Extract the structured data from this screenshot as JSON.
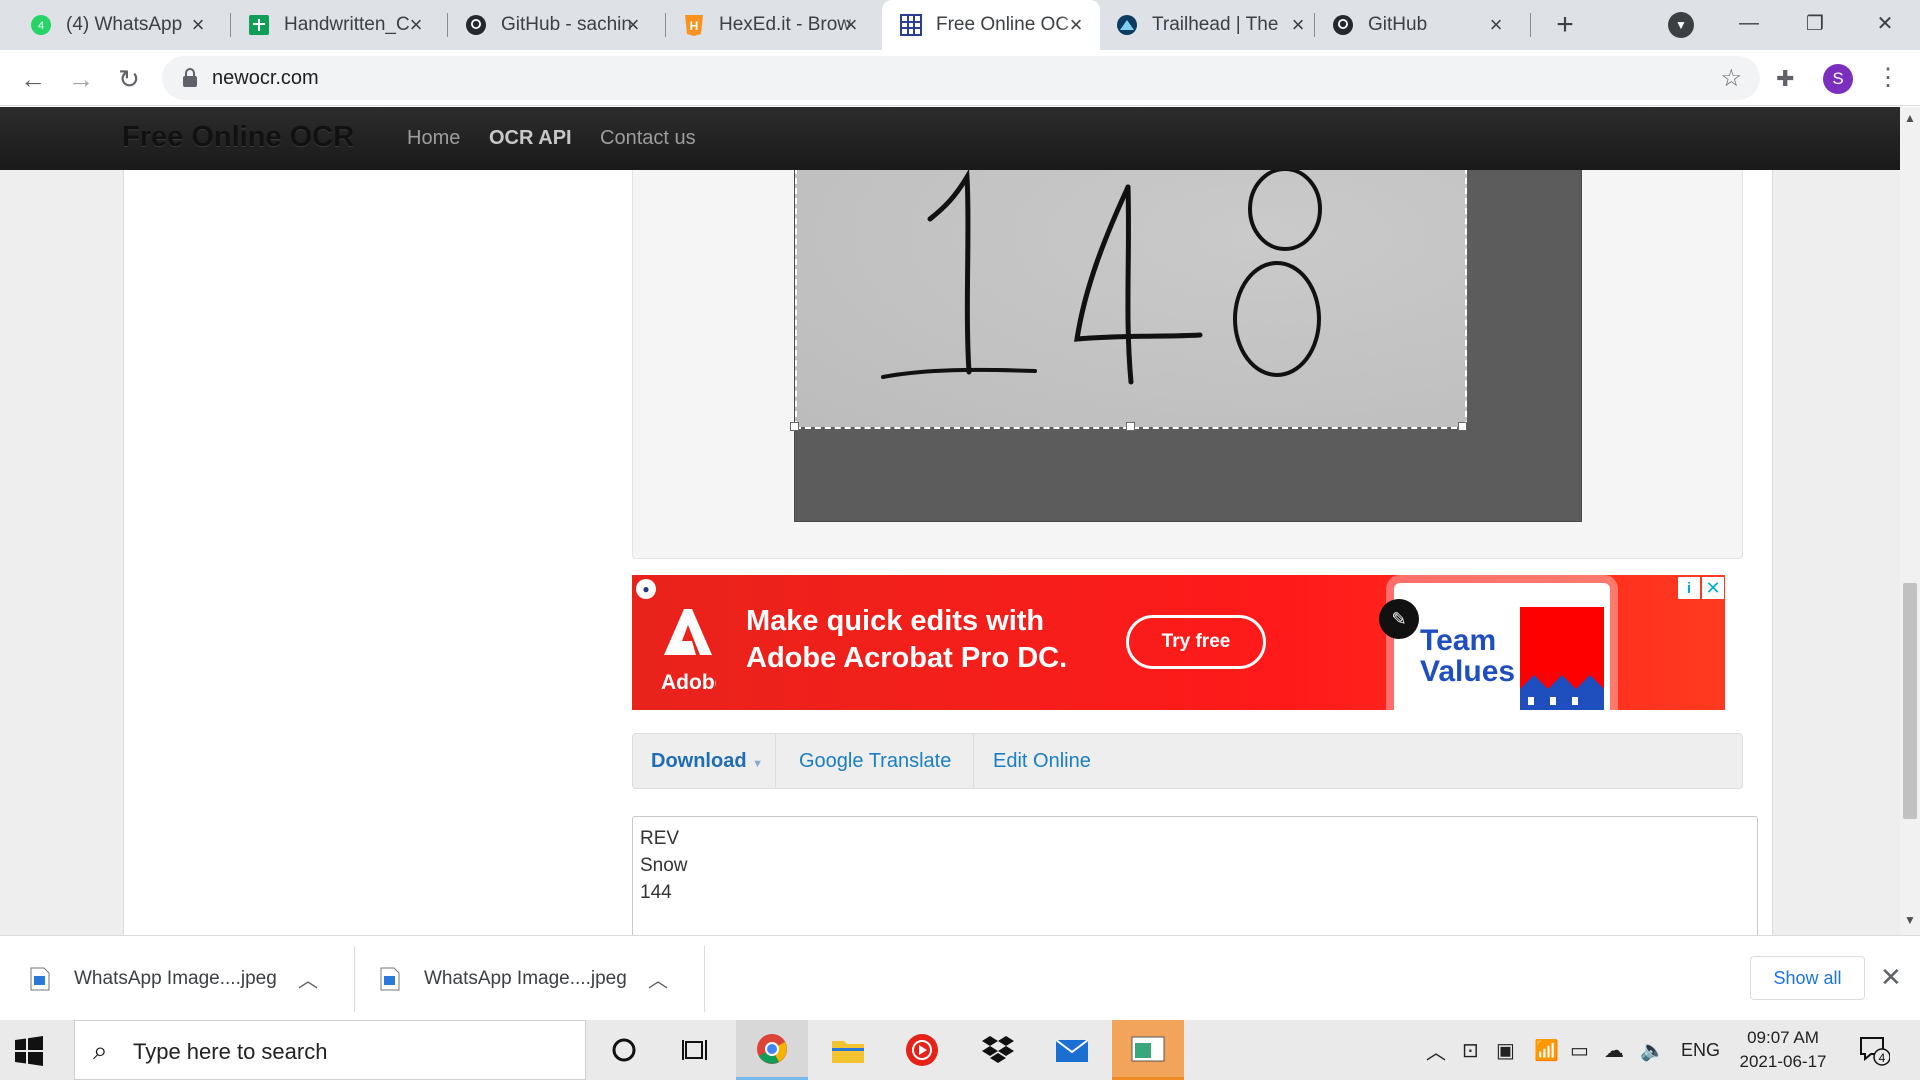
{
  "browser": {
    "tabs": [
      {
        "title": "(4) WhatsApp",
        "icon": "whatsapp-icon"
      },
      {
        "title": "Handwritten_C",
        "icon": "sheets-icon"
      },
      {
        "title": "GitHub - sachin",
        "icon": "github-icon"
      },
      {
        "title": "HexEd.it - Brow",
        "icon": "hexed-icon"
      },
      {
        "title": "Free Online OC",
        "icon": "ocr-icon",
        "active": true
      },
      {
        "title": "Trailhead | The",
        "icon": "trailhead-icon"
      },
      {
        "title": "GitHub",
        "icon": "github-icon"
      }
    ],
    "url": "newocr.com",
    "profile_initial": "S"
  },
  "site": {
    "brand": "Free Online OCR",
    "nav": [
      "Home",
      "OCR API",
      "Contact us"
    ],
    "image_digits": "148"
  },
  "ad": {
    "brand": "Adobe",
    "headline_line1": "Make quick edits with",
    "headline_line2": "Adobe Acrobat Pro DC.",
    "cta": "Try free",
    "card_text_line1": "Team",
    "card_text_line2": "Values",
    "accent_color": "#ff1a1a"
  },
  "actions": {
    "download": "Download",
    "translate": "Google Translate",
    "edit": "Edit Online"
  },
  "ocr_result": [
    "REV",
    "Snow",
    "144"
  ],
  "downloads": {
    "items": [
      "WhatsApp Image....jpeg",
      "WhatsApp Image....jpeg"
    ],
    "show_all": "Show all"
  },
  "taskbar": {
    "search_placeholder": "Type here to search",
    "language": "ENG",
    "time": "09:07 AM",
    "date": "2021-06-17",
    "notification_count": "4"
  }
}
